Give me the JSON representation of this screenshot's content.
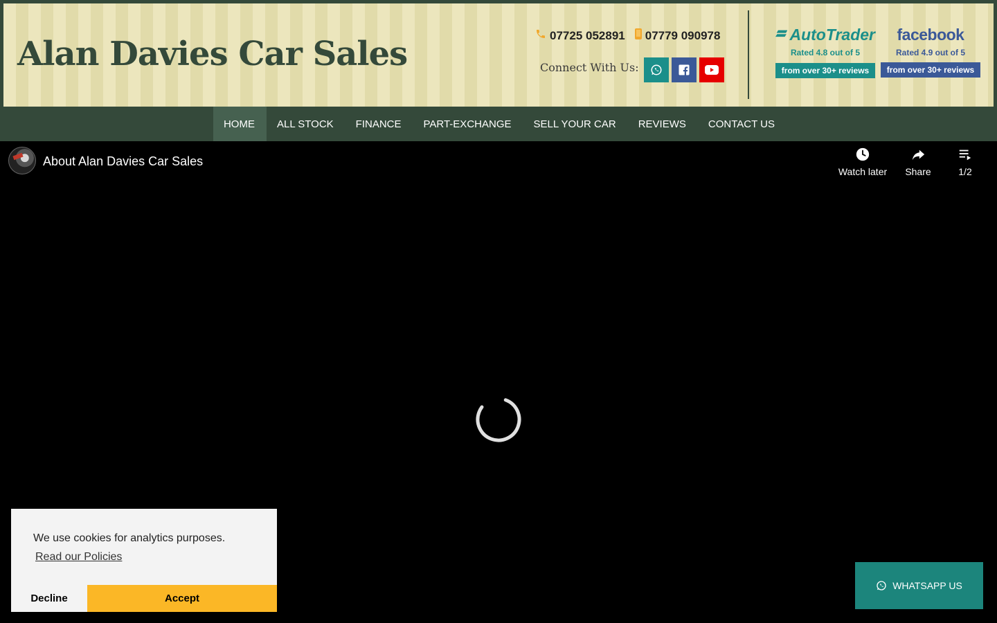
{
  "header": {
    "site_title": "Alan Davies Car Sales",
    "phones": [
      {
        "number": "07725 052891",
        "icon": "phone-icon"
      },
      {
        "number": "07779 090978",
        "icon": "mobile-icon"
      }
    ],
    "connect_label": "Connect With Us:",
    "social": [
      {
        "name": "whatsapp",
        "icon": "whatsapp-icon",
        "color": "#1b8f8a"
      },
      {
        "name": "facebook",
        "icon": "facebook-icon",
        "color": "#3b5998"
      },
      {
        "name": "youtube",
        "icon": "youtube-icon",
        "color": "#e60000"
      }
    ],
    "ratings": {
      "autotrader": {
        "logo": "AutoTrader",
        "rating_text": "Rated 4.8 out of 5",
        "badge": "from over 30+ reviews",
        "color": "#1b8f8a"
      },
      "facebook": {
        "logo": "facebook",
        "rating_text": "Rated 4.9 out of 5",
        "badge": "from over 30+ reviews",
        "color": "#3b5998"
      }
    }
  },
  "nav": {
    "items": [
      "HOME",
      "ALL STOCK",
      "FINANCE",
      "PART-EXCHANGE",
      "SELL YOUR CAR",
      "REVIEWS",
      "CONTACT US"
    ],
    "active": "HOME"
  },
  "video": {
    "title": "About Alan Davies Car Sales",
    "watch_later": "Watch later",
    "share": "Share",
    "playlist_position": "1/2"
  },
  "cookie": {
    "message": "We use cookies for analytics purposes.",
    "link": "Read our Policies",
    "decline": "Decline",
    "accept": "Accept"
  },
  "whatsapp_float": {
    "label": "WHATSAPP US"
  },
  "colors": {
    "brand_green": "#34493a",
    "nav_active": "#466150",
    "accent_yellow": "#fbb726",
    "whatsapp_teal": "#1c857c"
  }
}
